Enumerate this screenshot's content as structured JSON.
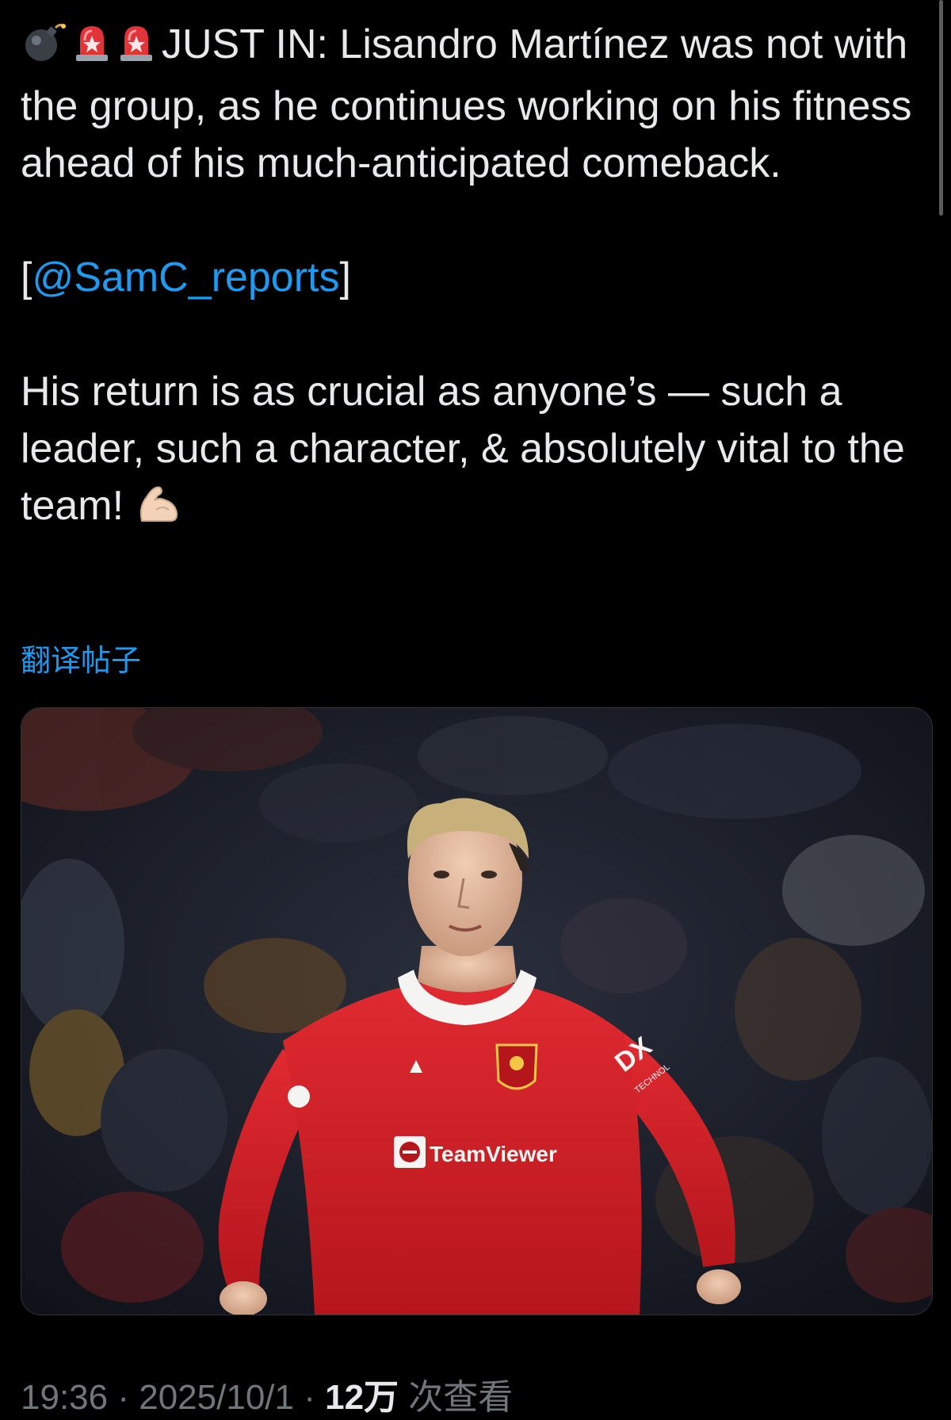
{
  "post": {
    "lead_emojis": [
      "bomb-icon",
      "siren-icon",
      "siren-icon"
    ],
    "headline_text": "JUST IN: Lisandro Martínez was not with the group, as he continues working on his fitness ahead of his much-anticipated comeback.",
    "mention_open": "[",
    "mention": "@SamC_reports",
    "mention_close": "]",
    "comment_text": "His return is as crucial as anyone’s — such a leader, such a character, & absolutely vital to the team!",
    "comment_emoji": "flexed-biceps-icon",
    "translate_label": "翻译帖子"
  },
  "media": {
    "kit_sponsor": "TeamViewer",
    "sleeve_sponsor": "DX",
    "sleeve_sponsor_sub": "TECHNOL"
  },
  "meta": {
    "time": "19:36",
    "separator": "·",
    "date": "2025/10/1",
    "views_count": "12万",
    "views_label": "次查看"
  },
  "colors": {
    "background": "#000000",
    "text": "#e7e9ea",
    "link": "#1d9bf0",
    "muted": "#71767b",
    "shirt_red": "#d51d24"
  }
}
